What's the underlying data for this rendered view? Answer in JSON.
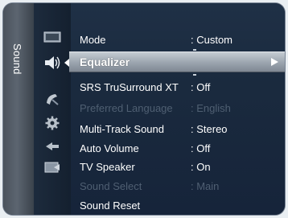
{
  "side_tab": {
    "label": "Sound"
  },
  "icons": [
    "picture-icon",
    "sound-icon",
    "channel-icon",
    "setup-icon",
    "input-icon",
    "application-icon"
  ],
  "menu": {
    "rows": [
      {
        "label": "Mode",
        "value": ": Custom",
        "state": "normal"
      },
      {
        "label": "Equalizer",
        "value": "",
        "state": "selected",
        "arrow": "►"
      },
      {
        "label": "SRS TruSurround XT",
        "value": ": Off",
        "state": "normal"
      },
      {
        "label": "Preferred Language",
        "value": ": English",
        "state": "disabled"
      },
      {
        "label": "Multi-Track Sound",
        "value": ": Stereo",
        "state": "normal"
      },
      {
        "label": "Auto Volume",
        "value": ": Off",
        "state": "normal"
      },
      {
        "label": "TV Speaker",
        "value": ": On",
        "state": "normal"
      },
      {
        "label": "Sound Select",
        "value": ": Main",
        "state": "disabled"
      },
      {
        "label": "Sound Reset",
        "value": "",
        "state": "normal"
      }
    ]
  },
  "colors": {
    "panel": "#1a2a3e",
    "selected_bar": "#a3acb6",
    "disabled_text": "#4f5f72",
    "text": "#ffffff"
  }
}
